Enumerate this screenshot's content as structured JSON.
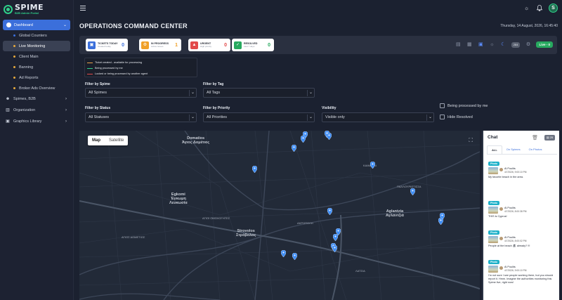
{
  "brand": {
    "name": "SPIME",
    "subtitle": "B2B Admin Portal",
    "accent": "#2fd08a"
  },
  "sidebar": {
    "dashboard": {
      "label": "Dashboard",
      "icon": "dashboard-icon"
    },
    "sub_items": [
      {
        "label": "Global Counters",
        "dot": "#3b6fdb",
        "active": false
      },
      {
        "label": "Live Monitoring",
        "dot": "#e7a93b",
        "active": true
      },
      {
        "label": "Client Main",
        "dot": "#e7a93b",
        "active": false
      },
      {
        "label": "Banning",
        "dot": "#e7a93b",
        "active": false
      },
      {
        "label": "Ad Reports",
        "dot": "#e7a93b",
        "active": false
      },
      {
        "label": "Broker Ads Overview",
        "dot": "#e7a93b",
        "active": false
      }
    ],
    "groups": [
      {
        "label": "Spimes, B2B",
        "icon": "people-icon"
      },
      {
        "label": "Organization",
        "icon": "building-icon"
      },
      {
        "label": "Graphics Library",
        "icon": "image-icon"
      }
    ]
  },
  "topbar": {
    "avatar_letter": "S"
  },
  "header": {
    "title": "OPERATIONS COMMAND CENTER",
    "date": "Thursday, 14 August, 2026, 16:45:40"
  },
  "stats": [
    {
      "label": "TICKETS TODAY",
      "sub": "Created today",
      "value": "0",
      "color": "#3b6fdb",
      "icon": "ticket-icon"
    },
    {
      "label": "IN PROGRESS",
      "sub": "Active issues",
      "value": "1",
      "color": "#f0a028",
      "icon": "wrench-icon"
    },
    {
      "label": "URGENT",
      "sub": "High priority",
      "value": "0",
      "color": "#e24a4a",
      "icon": "flame-icon"
    },
    {
      "label": "RESOLVED",
      "sub": "Last 7 days",
      "value": "0",
      "color": "#27a95f",
      "icon": "check-icon"
    }
  ],
  "toolbar": {
    "count_pill": "284",
    "live_label": "Live - 0"
  },
  "legend": [
    {
      "text": "Ticket created - available for processing",
      "color": "#e8a24a"
    },
    {
      "text": "Being processed by me",
      "color": "#2fd08a"
    },
    {
      "text": "Locked or being processed by another agent",
      "color": "#e24a4a"
    }
  ],
  "filters": {
    "spime": {
      "label": "Filter by Spime",
      "value": "All Spimes"
    },
    "tag": {
      "label": "Filter by Tag",
      "value": "All Tags"
    },
    "status": {
      "label": "Filter by Status",
      "value": "All Statuses"
    },
    "priority": {
      "label": "Filter by Priority",
      "value": "All Priorities"
    },
    "visibility": {
      "label": "Visibility",
      "value": "Visible only"
    },
    "being_processed": "Being processed by me",
    "hide_resolved": "Hide Resolved"
  },
  "map": {
    "tab_map": "Map",
    "tab_satellite": "Satellite",
    "places": [
      {
        "text": "Domatios\nΆγιος Δομέτιος"
      },
      {
        "text": "Egkomi\nΈγκωμη\nΛευκωσία"
      },
      {
        "text": "Aglantzia\nΑγλαντζιά"
      },
      {
        "text": "Strovolos\nΣτρόβολος"
      },
      {
        "text": "ΚΑΙΜΑΚΛΙ"
      },
      {
        "text": "ΑΓΙΟΙ ΟΜΟΛΟΓΗΤΕΣ"
      },
      {
        "text": "ΠΑΛΛΟΥΡΙΩΤΙΣΣΑ"
      },
      {
        "text": "ΑΚΡΟΠΟΛΗ"
      },
      {
        "text": "ΛΑΤΣΙΑ"
      },
      {
        "text": "ΑΓΙΟΣ ΔΟΜΕΤΙΟΣ"
      }
    ]
  },
  "chat": {
    "title": "Chat",
    "button": "▤ 25",
    "tabs": [
      "ALL",
      "On Spimes",
      "On Photos"
    ],
    "messages": [
      {
        "badge": "Photo",
        "name": "Al Poulits",
        "time": "4/7/2026, 9:00:10 PM",
        "text": "My favorite beach in the area."
      },
      {
        "badge": "Photo",
        "name": "Al Poulits",
        "time": "4/7/2026, 8:00:38 PM",
        "text": "THIS is Cyprus!"
      },
      {
        "badge": "Photo",
        "name": "Al Poulits",
        "time": "4/7/2026, 8:00:02 PM",
        "text": "People at the beach 🏖 already? !!!"
      },
      {
        "badge": "Photo",
        "name": "Al Poulits",
        "time": "4/7/2026, 9:00:10 PM",
        "text": "I'm not sure I see people working there, but you should report it. Hmm. Imagine the authorities monitoring this Spime live, right now!"
      }
    ]
  }
}
